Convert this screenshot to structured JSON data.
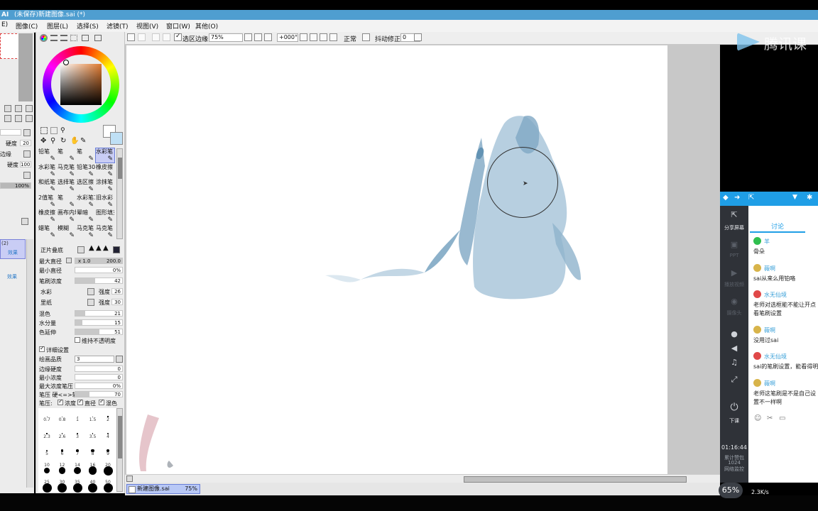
{
  "window": {
    "title": "(未保存)新建图像.sai (*)"
  },
  "menu": [
    "图像(C)",
    "图层(L)",
    "选择(S)",
    "滤镜(T)",
    "视图(V)",
    "窗口(W)",
    "其他(O)"
  ],
  "menu_partial_first": "E)",
  "toolbar": {
    "selection_edge_label": "选区边缘",
    "zoom": "75%",
    "rotation": "+000°",
    "blend_mode": "正常",
    "stabilizer_label": "抖动修正",
    "stabilizer_value": "0"
  },
  "brush_tools": [
    [
      "铅笔",
      "笔",
      "笔",
      "水彩笔"
    ],
    [
      "水彩笔",
      "马克笔",
      "铅笔30",
      "橡皮擦"
    ],
    [
      "和纸笔",
      "选择笔",
      "选区擦",
      "涂抹笔"
    ],
    [
      "2值笔",
      "笔",
      "水彩笔10%",
      "旧水彩"
    ],
    [
      "橡皮擦",
      "画布内填",
      "晕暗",
      "图形填充"
    ],
    [
      "蜡笔",
      "模糊",
      "马克笔",
      "马克笔"
    ]
  ],
  "brush_settings": {
    "shape_mode": "正片叠底",
    "max_size_label": "最大直径",
    "max_size_mult": "x 1.0",
    "max_size_value": "200.0",
    "min_size_label": "最小直径",
    "min_size_value": "0%",
    "density_label": "笔刷浓度",
    "density_value": "42",
    "texture1": "水彩",
    "texture1_strength_label": "强度",
    "texture1_strength": "26",
    "texture2": "里纸",
    "texture2_strength_label": "强度",
    "texture2_strength": "30",
    "blend_label": "混色",
    "blend_value": "21",
    "water_label": "水分量",
    "water_value": "15",
    "persist_label": "色延伸",
    "persist_value": "51",
    "keep_opacity": "维持不透明度",
    "advanced": "详细设置",
    "quality_label": "绘画品质",
    "quality_value": "3",
    "edge_label": "边缘硬度",
    "edge_value": "0",
    "min_density_label": "最小浓度",
    "min_density_value": "0",
    "max_pressure_label": "最大浓度笔压",
    "max_pressure_value": "0%",
    "pressure_hard_label": "笔压 硬<=>软",
    "pressure_hard_value": "70",
    "pressure_label": "笔压:",
    "pressure_opts": [
      "浓度",
      "直径",
      "混色"
    ]
  },
  "dot_sizes": [
    [
      "0.7",
      "0.8",
      "1",
      "1.5",
      "2"
    ],
    [
      "2.3",
      "2.6",
      "3",
      "3.5",
      "4"
    ],
    [
      "5",
      "6",
      "7",
      "8",
      "9"
    ],
    [
      "10",
      "12",
      "14",
      "16",
      "20"
    ],
    [
      "25",
      "30",
      "35",
      "40",
      "50"
    ]
  ],
  "left_panel": {
    "hardness_label": "硬度",
    "hardness1": "20",
    "hardness2": "100",
    "opacity": "100%",
    "edge_label": "边缘",
    "layer_name": "(2)",
    "layer_effect1": "效果",
    "layer_effect2": "效果"
  },
  "document_tab": {
    "name": "新建图像.sai",
    "zoom": "75%"
  },
  "watermark": "腾讯课",
  "chat": {
    "tab_label": "讨论",
    "sidebar": [
      {
        "icon": "share-screen-icon",
        "label": "分享屏幕"
      },
      {
        "icon": "ppt-icon",
        "label": "PPT"
      },
      {
        "icon": "video-icon",
        "label": "播放视频"
      },
      {
        "icon": "camera-icon",
        "label": "摄像头"
      },
      {
        "icon": "mic-icon",
        "label": ""
      },
      {
        "icon": "speaker-icon",
        "label": ""
      },
      {
        "icon": "music-icon",
        "label": ""
      },
      {
        "icon": "fullscreen-icon",
        "label": ""
      },
      {
        "icon": "end-class-icon",
        "label": "下课"
      }
    ],
    "time": "01:16:44",
    "stats": [
      "累计赞包",
      "1024",
      "网络监控"
    ],
    "messages": [
      {
        "name": "羊",
        "text": "骨朵"
      },
      {
        "name": "薇啊",
        "text": "sai从来么用铂咯"
      },
      {
        "name": "水无仙境",
        "text": "老师对选框能不能让开点看笔刷设置"
      },
      {
        "name": "薇啊",
        "text": "没用过sai"
      },
      {
        "name": "水无仙境",
        "text": "sai的笔刷设置，能看得明"
      },
      {
        "name": "薇啊",
        "text": "老师这笔刷是不是自己设置不一样啊"
      }
    ]
  },
  "bottom_status": {
    "cpu": "65%",
    "net": "2.3K/s"
  },
  "colors": {
    "accent": "#4f9ed0",
    "chat_header": "#1f9ee6",
    "paint": "#7fa8c4"
  }
}
